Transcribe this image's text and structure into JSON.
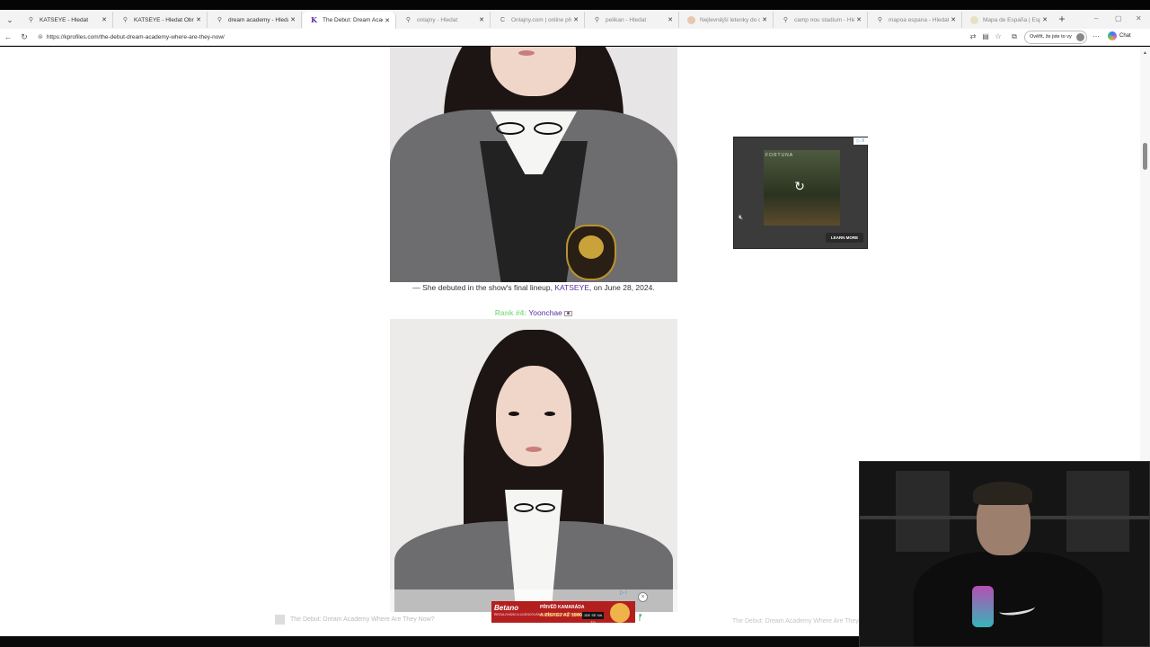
{
  "browser": {
    "tabs": [
      {
        "title": "KATSEYE - Hledat",
        "icon": "search-icon"
      },
      {
        "title": "KATSEYE - Hledat Obrázky",
        "icon": "search-icon"
      },
      {
        "title": "dream academy - Hledat",
        "icon": "search-icon"
      },
      {
        "title": "The Debut: Dream Academy",
        "icon": "kprofiles-icon",
        "active": true
      },
      {
        "title": "onlajny - Hledat",
        "icon": "search-icon"
      },
      {
        "title": "Onlajny.com | online přeno",
        "icon": "site-icon"
      },
      {
        "title": "pelikan - Hledat",
        "icon": "search-icon"
      },
      {
        "title": "Nejlevnější letenky do celé",
        "icon": "site-icon"
      },
      {
        "title": "camp nou stadium - Hledat",
        "icon": "search-icon"
      },
      {
        "title": "mapoa espana - Hledat",
        "icon": "search-icon"
      },
      {
        "title": "Mapa de España | España M",
        "icon": "site-icon"
      }
    ],
    "url": "https://kprofiles.com/the-debut-dream-academy-where-are-they-now/",
    "verify_label": "Ověřit, že jste to vy",
    "chat_label": "Chat"
  },
  "article": {
    "caption_prefix": "— She debuted in the show's final lineup, ",
    "caption_link": "KATSEYE",
    "caption_suffix": ", on June 28, 2024.",
    "rank_label": "Rank #4:",
    "rank_name": "Yoonchae"
  },
  "ad_top": {
    "brand": "FORTUNA",
    "cta": "LEARN MORE",
    "choices": "▷ X"
  },
  "footer_nav": {
    "prev": "The Debut: Dream Academy Where Are They Now?",
    "next": "The Debut: Dream Academy Where Are They Now?"
  },
  "ad_bottom": {
    "brand": "Betano",
    "line1": "PŘIVĚĎ KAMARÁDA",
    "line2": "A ZÍSKEJ AŽ 1500 KČ!",
    "button": "JDE SE NA TO",
    "tagline": "REGULOVÁNO A LICENCOVÁNO MINISTERSTVEM FINANCÍ",
    "close": "×"
  }
}
